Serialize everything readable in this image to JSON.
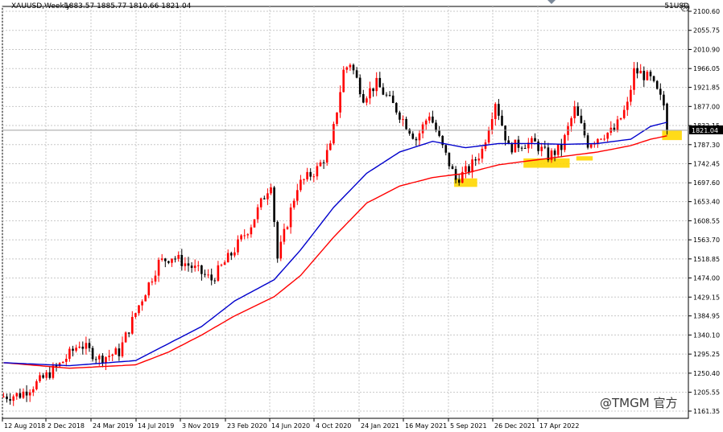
{
  "header": {
    "symbol": "XAUUSD,Weekly",
    "ohlc": "1883.57 1885.77 1810.66 1821.04",
    "corner_label": "51USD"
  },
  "watermark": "@TMGM 官方",
  "colors": {
    "bull": "#ff0000",
    "bear": "#000000",
    "ma_fast": "#0000cc",
    "ma_slow": "#ff0000",
    "highlight": "#ffd700",
    "price_label_bg": "#000000",
    "grid": "#c8c8c8"
  },
  "icons": {
    "close": "close-circle-icon",
    "scroll": "triangle-down-icon"
  },
  "chart_data": {
    "type": "candlestick",
    "title": "XAUUSD,Weekly",
    "last_price": 1821.04,
    "last_price_label": "1821.04",
    "y_ticks": [
      "2100.60",
      "2055.75",
      "2010.90",
      "1966.05",
      "1921.85",
      "1877.00",
      "1832.15",
      "1787.30",
      "1742.45",
      "1697.60",
      "1653.40",
      "1608.55",
      "1563.70",
      "1518.85",
      "1474.00",
      "1429.15",
      "1384.95",
      "1340.10",
      "1295.25",
      "1250.40",
      "1205.55",
      "1161.35"
    ],
    "y_tick_values": [
      2100.6,
      2055.75,
      2010.9,
      1966.05,
      1921.85,
      1877.0,
      1832.15,
      1787.3,
      1742.45,
      1697.6,
      1653.4,
      1608.55,
      1563.7,
      1518.85,
      1474.0,
      1429.15,
      1384.95,
      1340.1,
      1295.25,
      1250.4,
      1205.55,
      1161.35
    ],
    "x_labels": [
      "12 Aug 2018",
      "2 Dec 2018",
      "24 Mar 2019",
      "14 Jul 2019",
      "3 Nov 2019",
      "23 Feb 2020",
      "14 Jun 2020",
      "4 Oct 2020",
      "24 Jan 2021",
      "16 May 2021",
      "5 Sep 2021",
      "26 Dec 2021",
      "17 Apr 2022"
    ],
    "anchors": [
      {
        "i": 0,
        "p": 1195
      },
      {
        "i": 6,
        "p": 1200
      },
      {
        "i": 12,
        "p": 1232
      },
      {
        "i": 18,
        "p": 1270
      },
      {
        "i": 24,
        "p": 1320
      },
      {
        "i": 30,
        "p": 1285
      },
      {
        "i": 36,
        "p": 1300
      },
      {
        "i": 42,
        "p": 1410
      },
      {
        "i": 48,
        "p": 1510
      },
      {
        "i": 52,
        "p": 1525
      },
      {
        "i": 58,
        "p": 1500
      },
      {
        "i": 64,
        "p": 1470
      },
      {
        "i": 70,
        "p": 1530
      },
      {
        "i": 76,
        "p": 1600
      },
      {
        "i": 82,
        "p": 1700
      },
      {
        "i": 84,
        "p": 1520
      },
      {
        "i": 90,
        "p": 1690
      },
      {
        "i": 96,
        "p": 1730
      },
      {
        "i": 100,
        "p": 1780
      },
      {
        "i": 104,
        "p": 1960
      },
      {
        "i": 106,
        "p": 1980
      },
      {
        "i": 110,
        "p": 1900
      },
      {
        "i": 114,
        "p": 1930
      },
      {
        "i": 120,
        "p": 1870
      },
      {
        "i": 126,
        "p": 1800
      },
      {
        "i": 130,
        "p": 1860
      },
      {
        "i": 134,
        "p": 1780
      },
      {
        "i": 138,
        "p": 1705
      },
      {
        "i": 142,
        "p": 1730
      },
      {
        "i": 146,
        "p": 1775
      },
      {
        "i": 150,
        "p": 1890
      },
      {
        "i": 154,
        "p": 1780
      },
      {
        "i": 158,
        "p": 1790
      },
      {
        "i": 162,
        "p": 1790
      },
      {
        "i": 166,
        "p": 1760
      },
      {
        "i": 170,
        "p": 1780
      },
      {
        "i": 174,
        "p": 1870
      },
      {
        "i": 178,
        "p": 1790
      },
      {
        "i": 182,
        "p": 1810
      },
      {
        "i": 186,
        "p": 1820
      },
      {
        "i": 190,
        "p": 1880
      },
      {
        "i": 192,
        "p": 1960
      },
      {
        "i": 194,
        "p": 1955
      },
      {
        "i": 197,
        "p": 1940
      },
      {
        "i": 199,
        "p": 1910
      },
      {
        "i": 201,
        "p": 1880
      }
    ],
    "last_candle": {
      "open": 1883.57,
      "high": 1885.77,
      "low": 1810.66,
      "close": 1821.04
    },
    "ma_fast_anchors": [
      {
        "i": 0,
        "p": 1275
      },
      {
        "i": 20,
        "p": 1268
      },
      {
        "i": 40,
        "p": 1280
      },
      {
        "i": 60,
        "p": 1360
      },
      {
        "i": 70,
        "p": 1420
      },
      {
        "i": 82,
        "p": 1470
      },
      {
        "i": 90,
        "p": 1540
      },
      {
        "i": 100,
        "p": 1640
      },
      {
        "i": 110,
        "p": 1720
      },
      {
        "i": 120,
        "p": 1770
      },
      {
        "i": 130,
        "p": 1795
      },
      {
        "i": 140,
        "p": 1780
      },
      {
        "i": 150,
        "p": 1790
      },
      {
        "i": 160,
        "p": 1790
      },
      {
        "i": 170,
        "p": 1788
      },
      {
        "i": 180,
        "p": 1790
      },
      {
        "i": 190,
        "p": 1800
      },
      {
        "i": 196,
        "p": 1830
      },
      {
        "i": 201,
        "p": 1840
      }
    ],
    "ma_slow_anchors": [
      {
        "i": 0,
        "p": 1275
      },
      {
        "i": 20,
        "p": 1262
      },
      {
        "i": 40,
        "p": 1270
      },
      {
        "i": 50,
        "p": 1300
      },
      {
        "i": 60,
        "p": 1340
      },
      {
        "i": 70,
        "p": 1385
      },
      {
        "i": 82,
        "p": 1430
      },
      {
        "i": 90,
        "p": 1480
      },
      {
        "i": 100,
        "p": 1570
      },
      {
        "i": 110,
        "p": 1650
      },
      {
        "i": 120,
        "p": 1690
      },
      {
        "i": 130,
        "p": 1710
      },
      {
        "i": 140,
        "p": 1720
      },
      {
        "i": 150,
        "p": 1740
      },
      {
        "i": 160,
        "p": 1750
      },
      {
        "i": 170,
        "p": 1760
      },
      {
        "i": 180,
        "p": 1770
      },
      {
        "i": 190,
        "p": 1785
      },
      {
        "i": 196,
        "p": 1800
      },
      {
        "i": 201,
        "p": 1808
      }
    ],
    "highlights": [
      {
        "i0": 137,
        "i1": 143,
        "p0": 1688,
        "p1": 1708
      },
      {
        "i0": 158,
        "i1": 171,
        "p0": 1733,
        "p1": 1755
      },
      {
        "i0": 174,
        "i1": 178,
        "p0": 1750,
        "p1": 1760
      },
      {
        "i0": 200,
        "i1": 205,
        "p0": 1798,
        "p1": 1820
      }
    ]
  }
}
